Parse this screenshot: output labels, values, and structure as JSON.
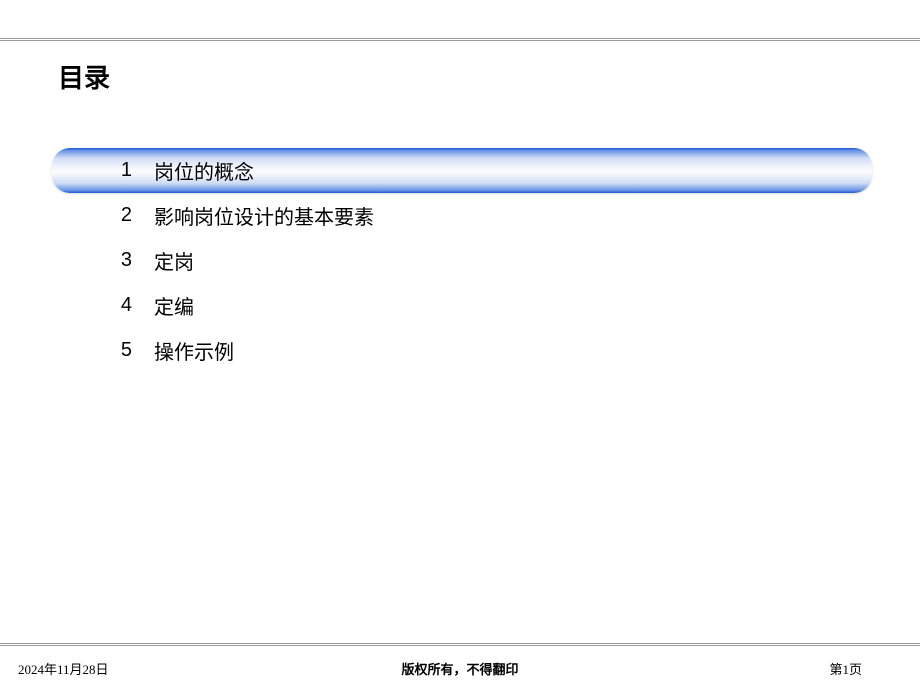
{
  "title": "目录",
  "toc": [
    {
      "number": "1",
      "label": "岗位的概念",
      "highlighted": true
    },
    {
      "number": "2",
      "label": "影响岗位设计的基本要素",
      "highlighted": false
    },
    {
      "number": "3",
      "label": "定岗",
      "highlighted": false
    },
    {
      "number": "4",
      "label": "定编",
      "highlighted": false
    },
    {
      "number": "5",
      "label": "操作示例",
      "highlighted": false
    }
  ],
  "footer": {
    "date": "2024年11月28日",
    "copyright": "版权所有，不得翻印",
    "page": "第1页"
  }
}
